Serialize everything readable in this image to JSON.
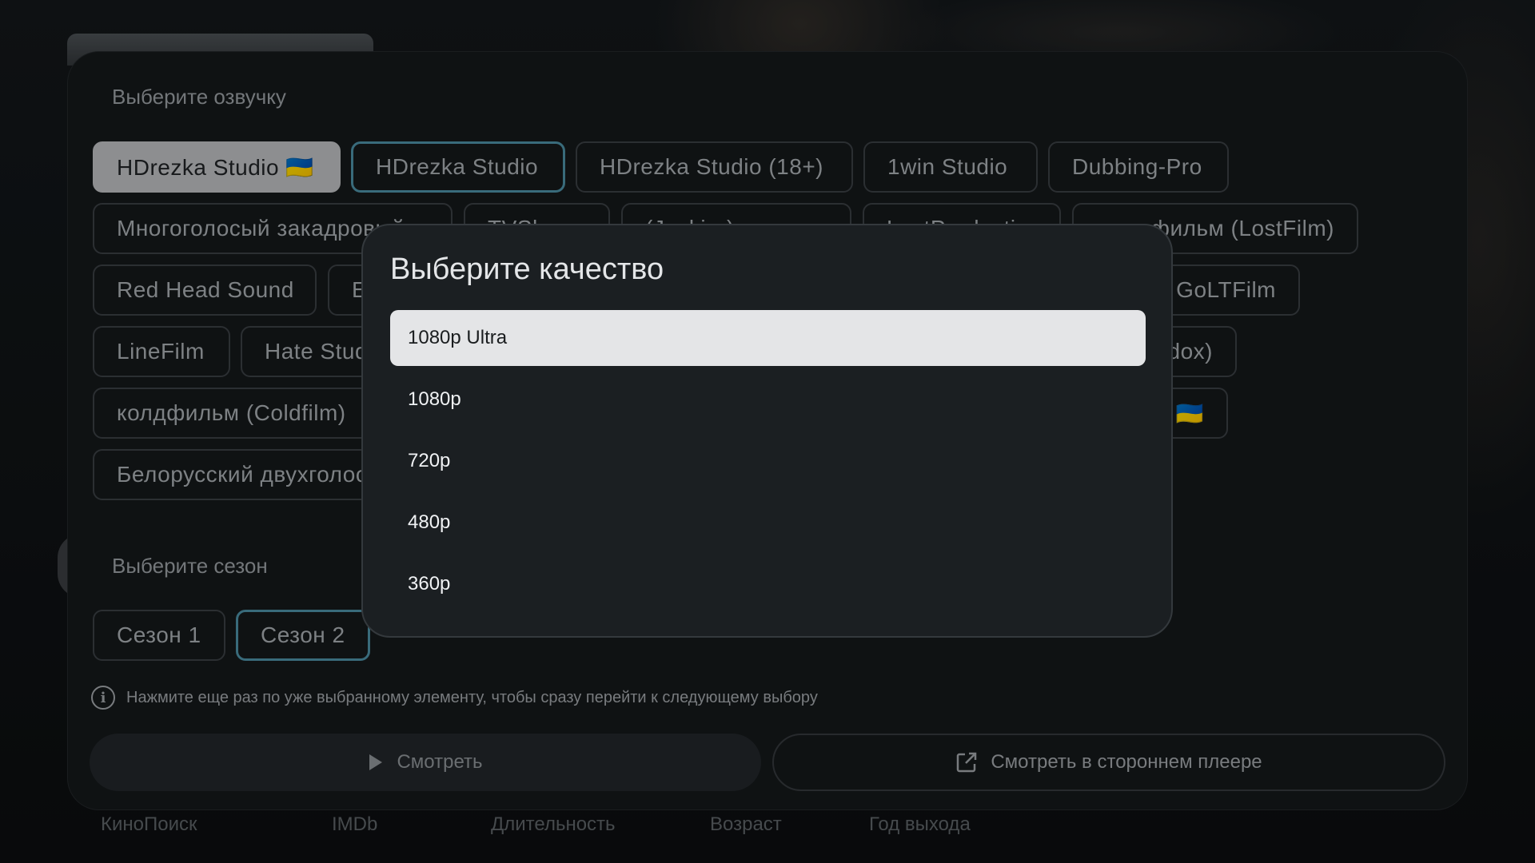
{
  "voice_section": {
    "title": "Выберите озвучку",
    "chips": [
      "HDrezka Studio 🇺🇦",
      "HDrezka Studio",
      "HDrezka Studio (18+)",
      "1win Studio",
      "Dubbing-Pro",
      "Многоголосый закадровый",
      "TVShows",
      "(Jaskier)",
      "LostProduction",
      "фильм (LostFilm)",
      "Red Head Sound",
      "E",
      "GoLTFilm",
      "LineFilm",
      "Hate Studio",
      "dox)",
      "колдфильм (Coldfilm)",
      "🇺🇦",
      "Белорусский двухголосый"
    ]
  },
  "season_section": {
    "title": "Выберите сезон",
    "seasons": [
      "Сезон 1",
      "Сезон 2"
    ]
  },
  "hint": "Нажмите еще раз по уже выбранному элементу, чтобы сразу перейти к следующему выбору",
  "actions": {
    "watch": "Смотреть",
    "watch_external": "Смотреть в стороннем плеере"
  },
  "footer": [
    "КиноПоиск",
    "IMDb",
    "Длительность",
    "Возраст",
    "Год выхода"
  ],
  "quality_dialog": {
    "title": "Выберите качество",
    "options": [
      "1080p Ultra",
      "1080p",
      "720p",
      "480p",
      "360p"
    ],
    "selected": "1080p Ultra"
  },
  "colors": {
    "panel": "#15181a",
    "accent_outline": "#4c8fa4",
    "selected_chip": "#bcbec0",
    "dialog_bg": "#1b1f22"
  },
  "icons": [
    "info-icon",
    "play-icon",
    "external-link-icon"
  ]
}
